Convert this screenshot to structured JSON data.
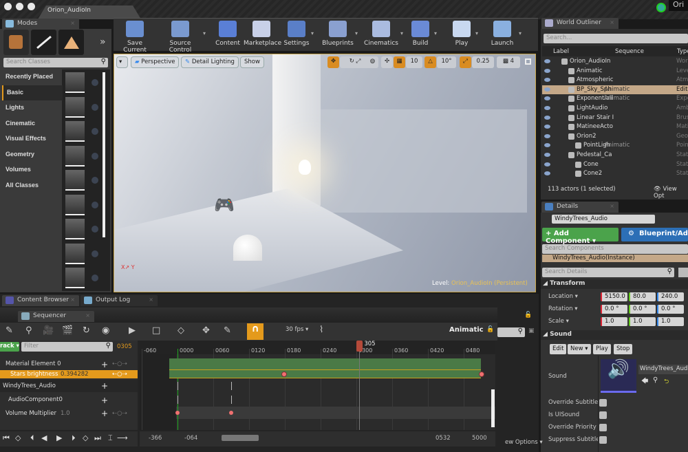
{
  "window": {
    "doc_tab": "Orion_AudioIn",
    "user_badge": "Ori"
  },
  "modes": {
    "tab": "Modes",
    "search_placeholder": "Search Classes",
    "categories": [
      "Recently Placed",
      "Basic",
      "Lights",
      "Cinematic",
      "Visual Effects",
      "Geometry",
      "Volumes",
      "All Classes"
    ],
    "selected": "Basic",
    "expand": "»"
  },
  "toolbar": {
    "buttons": [
      {
        "label": "Save Current",
        "icon": "floppy-icon"
      },
      {
        "label": "Source Control",
        "icon": "source-control-icon"
      },
      {
        "label": "Content",
        "icon": "content-icon"
      },
      {
        "label": "Marketplace",
        "icon": "marketplace-icon"
      },
      {
        "label": "Settings",
        "icon": "gear-icon"
      },
      {
        "label": "Blueprints",
        "icon": "blueprint-icon"
      },
      {
        "label": "Cinematics",
        "icon": "clapper-icon"
      },
      {
        "label": "Build",
        "icon": "build-icon"
      },
      {
        "label": "Play",
        "icon": "play-icon"
      },
      {
        "label": "Launch",
        "icon": "launch-icon"
      }
    ]
  },
  "viewport": {
    "perspective": "Perspective",
    "lighting": "Detail Lighting",
    "show": "Show",
    "grid_snap": "10",
    "rot_snap": "10°",
    "scale_snap": "0.25",
    "cam_speed": "4",
    "level_label": "Level:",
    "level_name": "Orion_AudioIn (Persistent)"
  },
  "outliner": {
    "tab": "World Outliner",
    "search_placeholder": "Search...",
    "columns": [
      "Label",
      "Sequence",
      "Type"
    ],
    "rows": [
      {
        "label": "Orion_AudioIn",
        "seq": "",
        "type": "World",
        "indent": 0
      },
      {
        "label": "Animatic",
        "seq": "",
        "type": "Level",
        "indent": 1
      },
      {
        "label": "Atmospheric",
        "seq": "",
        "type": "Atmo",
        "indent": 1
      },
      {
        "label": "BP_Sky_Sph",
        "seq": "Animatic",
        "type": "Edit",
        "indent": 1,
        "selected": true
      },
      {
        "label": "Exponentiall",
        "seq": "Animatic",
        "type": "Expo",
        "indent": 1
      },
      {
        "label": "LightAudio",
        "seq": "",
        "type": "Amb",
        "indent": 1
      },
      {
        "label": "Linear Stair I",
        "seq": "",
        "type": "Brus",
        "indent": 1
      },
      {
        "label": "MatineeActo",
        "seq": "",
        "type": "Mati",
        "indent": 1
      },
      {
        "label": "Orion2",
        "seq": "",
        "type": "Geor",
        "indent": 1
      },
      {
        "label": "PointLigh",
        "seq": "Animatic",
        "type": "Poin",
        "indent": 2
      },
      {
        "label": "Pedestal_Ca",
        "seq": "",
        "type": "Stati",
        "indent": 1
      },
      {
        "label": "Cone",
        "seq": "",
        "type": "Stati",
        "indent": 2
      },
      {
        "label": "Cone2",
        "seq": "",
        "type": "Stati",
        "indent": 2
      }
    ],
    "footer": "113 actors (1 selected)",
    "view_options": "View Opt"
  },
  "details": {
    "tab": "Details",
    "actor_name": "WindyTrees_Audio",
    "add_component": "+ Add Component ▾",
    "blueprint": "Blueprint/Add",
    "search_components": "Search Components",
    "instance": "WindyTrees_Audio(Instance)",
    "search_details": "Search Details",
    "transform": {
      "header": "Transform",
      "location_label": "Location ▾",
      "rotation_label": "Rotation ▾",
      "scale_label": "Scale ▾",
      "location": [
        "5150.0",
        "80.0",
        "240.0"
      ],
      "rotation": [
        "0.0 °",
        "0.0 °",
        "0.0 °"
      ],
      "scale": [
        "1.0",
        "1.0",
        "1.0"
      ]
    },
    "sound": {
      "header": "Sound",
      "buttons": [
        "Edit",
        "New ▾",
        "Play",
        "Stop"
      ],
      "sound_label": "Sound",
      "asset": "WindyTrees_Audio",
      "props": [
        {
          "label": "Override Subtitle F",
          "checked": false
        },
        {
          "label": "Is UISound",
          "checked": false
        },
        {
          "label": "Override Priority",
          "checked": false
        },
        {
          "label": "Suppress Subtitles",
          "checked": false
        }
      ]
    }
  },
  "bottom_tabs": [
    "Content Browser",
    "Output Log"
  ],
  "sequencer": {
    "tab": "Sequencer",
    "track_btn": "rack ▾",
    "filter_placeholder": "Filter",
    "current_frame": "0305",
    "fps": "30 fps ▾",
    "sequence_name": "Animatic",
    "view_options": "ew Options ▾",
    "ruler_ticks": [
      "-060",
      "0000",
      "0060",
      "0120",
      "0180",
      "0240",
      "0300",
      "0360",
      "0420",
      "0480"
    ],
    "tracks": [
      {
        "label": "Material Element 0",
        "value": ""
      },
      {
        "label": "Stars brightness",
        "value": "0.394282",
        "selected": true
      },
      {
        "label": "WindyTrees_Audio",
        "value": ""
      },
      {
        "label": "AudioComponent0",
        "value": ""
      },
      {
        "label": "Volume Multiplier",
        "value": "1.0"
      }
    ],
    "section_range": [
      -14,
      509
    ],
    "stars_keys": [
      179,
      510
    ],
    "volume_keys": [
      0,
      90
    ],
    "playhead": 305,
    "view_start": "-366",
    "view_in": "-064",
    "view_out": "0532",
    "view_end": "5000"
  },
  "colors": {
    "accent": "#e49a1c",
    "section": "#4a7a46",
    "key": "#f07070",
    "playhead": "#b54a3a"
  }
}
